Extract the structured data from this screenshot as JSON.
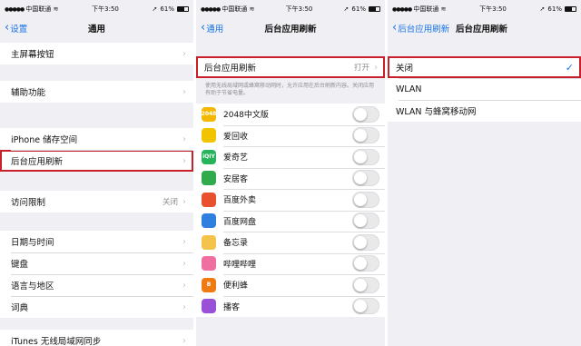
{
  "status": {
    "carrier": "中国联通",
    "time": "下午3:50",
    "battery": "61%"
  },
  "panel1": {
    "back": "设置",
    "title": "通用",
    "rows": {
      "home_button": "主屏幕按钮",
      "accessibility": "辅助功能",
      "storage": "iPhone 储存空间",
      "background_refresh": "后台应用刷新",
      "restrictions": "访问限制",
      "restrictions_value": "关闭",
      "date_time": "日期与时间",
      "keyboard": "键盘",
      "language_region": "语言与地区",
      "dictionary": "词典",
      "cutoff": "iTunes 无线局域网同步"
    }
  },
  "panel2": {
    "back": "通用",
    "title": "后台应用刷新",
    "setting_label": "后台应用刷新",
    "setting_value": "打开",
    "description": "使用无线局域网或蜂窝移动网时，允许应用在后台刷新内容。关闭应用有助于节省电量。",
    "apps": [
      "2048中文版",
      "爱回收",
      "爱奇艺",
      "安居客",
      "百度外卖",
      "百度网盘",
      "备忘录",
      "哔哩哔哩",
      "便利蜂",
      "播客"
    ],
    "app_icon_text": [
      "2048",
      "",
      "iQIY",
      "",
      "",
      "",
      "",
      "",
      "B",
      ""
    ],
    "app_colors": [
      "#f5b800",
      "#f2c400",
      "#27b35a",
      "#2faa4c",
      "#e8502e",
      "#2f7fe0",
      "#f3c34a",
      "#ef6fa0",
      "#f07a12",
      "#9b50d8"
    ]
  },
  "panel3": {
    "back": "后台应用刷新",
    "title": "后台应用刷新",
    "options": [
      "关闭",
      "WLAN",
      "WLAN 与蜂窝移动网"
    ],
    "selected": "✓"
  }
}
